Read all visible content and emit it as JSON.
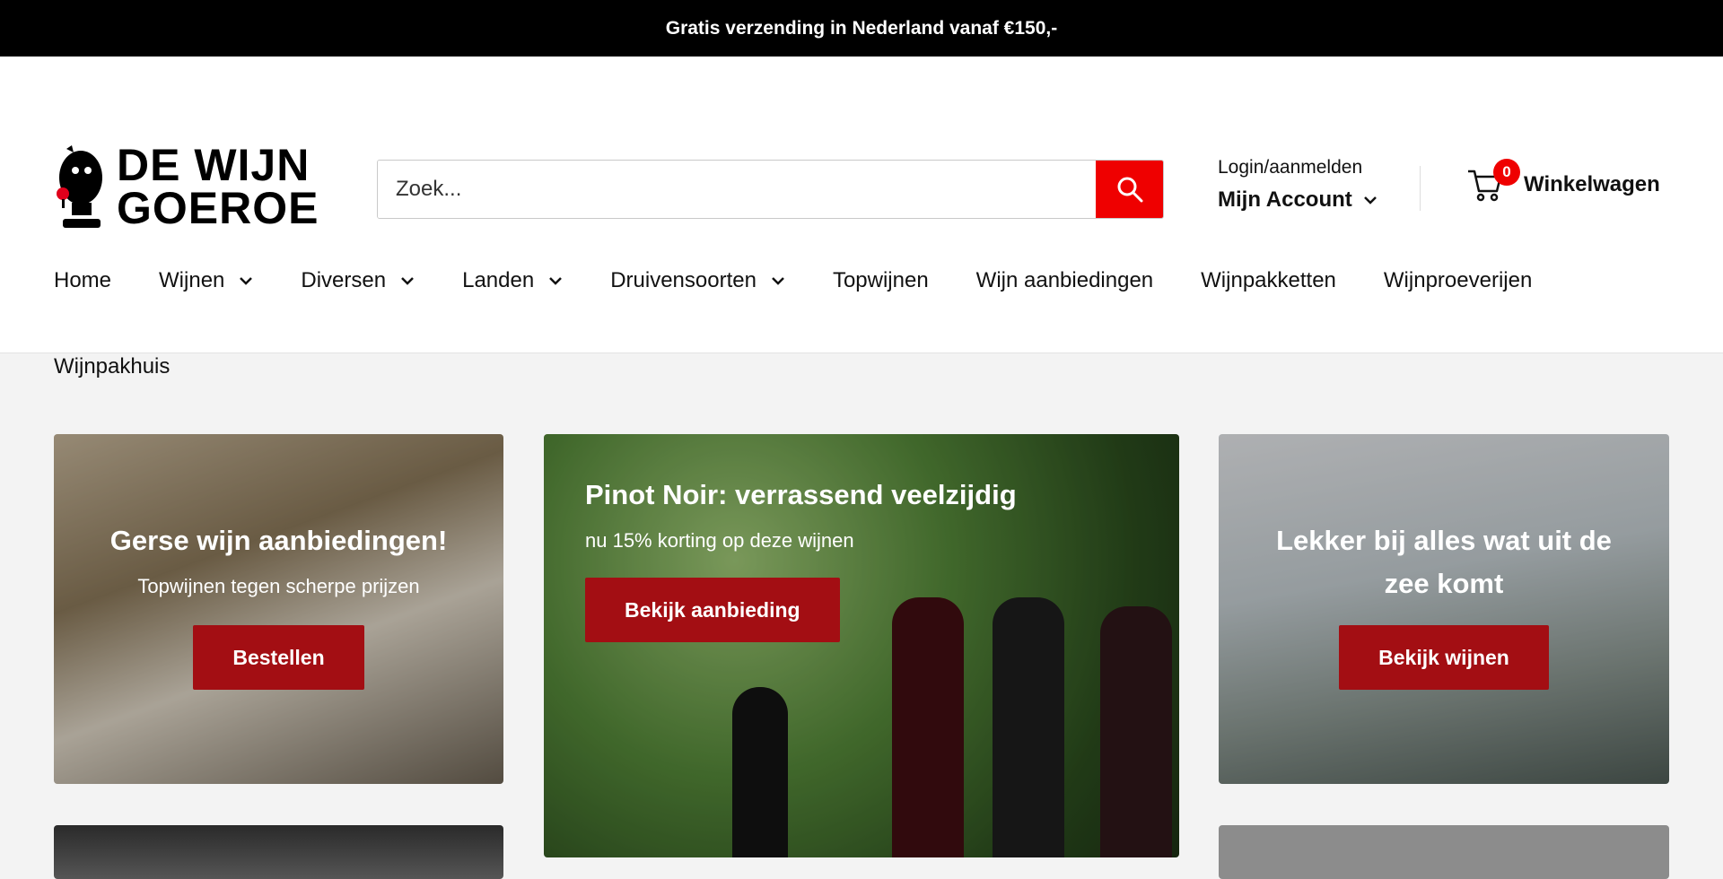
{
  "announcement": "Gratis verzending in Nederland vanaf €150,-",
  "logo": {
    "line1": "DE WIJN",
    "line2": "GOEROE"
  },
  "search": {
    "placeholder": "Zoek..."
  },
  "account": {
    "login": "Login/aanmelden",
    "mine": "Mijn Account"
  },
  "cart": {
    "count": "0",
    "label": "Winkelwagen"
  },
  "nav": {
    "row1": [
      {
        "label": "Home",
        "dropdown": false
      },
      {
        "label": "Wijnen",
        "dropdown": true
      },
      {
        "label": "Diversen",
        "dropdown": true
      },
      {
        "label": "Landen",
        "dropdown": true
      },
      {
        "label": "Druivensoorten",
        "dropdown": true
      },
      {
        "label": "Topwijnen",
        "dropdown": false
      },
      {
        "label": "Wijn aanbiedingen",
        "dropdown": false
      },
      {
        "label": "Wijnpakketten",
        "dropdown": false
      },
      {
        "label": "Wijnproeverijen",
        "dropdown": false
      }
    ],
    "row2": [
      {
        "label": "Wijnpakhuis",
        "dropdown": false
      }
    ]
  },
  "cards": [
    {
      "title": "Gerse wijn aanbiedingen!",
      "subtitle": "Topwijnen tegen scherpe prijzen",
      "button": "Bestellen"
    },
    {
      "title": "Pinot Noir: verrassend veelzijdig",
      "subtitle": "nu 15% korting op deze wijnen",
      "button": "Bekijk aanbieding"
    },
    {
      "title": "Lekker bij alles wat uit de zee komt",
      "subtitle": "",
      "button": "Bekijk wijnen"
    }
  ],
  "colors": {
    "accent": "#ef0000",
    "cta": "#a30e13",
    "announcement_bg": "#000000"
  }
}
